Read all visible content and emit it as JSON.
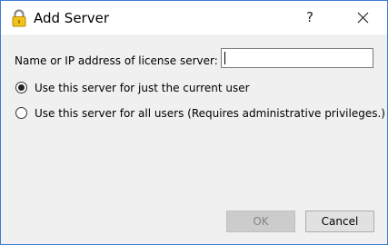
{
  "window": {
    "title": "Add Server",
    "help_glyph": "?",
    "title_icon": "lock-icon",
    "accent_border": "#3f7bd0"
  },
  "form": {
    "server_label": "Name or IP address of license server:",
    "server_value": "",
    "options": [
      {
        "label": "Use this server for just the current user",
        "selected": true
      },
      {
        "label": "Use this server for all users (Requires administrative privileges.)",
        "selected": false
      }
    ]
  },
  "buttons": {
    "ok_label": "OK",
    "ok_enabled": false,
    "cancel_label": "Cancel"
  }
}
